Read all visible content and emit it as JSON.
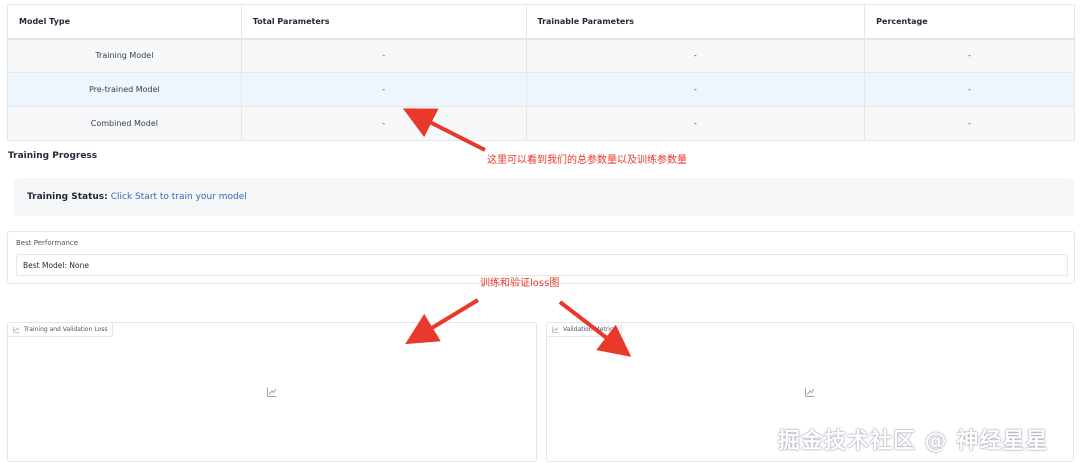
{
  "param_table": {
    "headers": [
      "Model Type",
      "Total Parameters",
      "Trainable Parameters",
      "Percentage"
    ],
    "rows": [
      [
        "Training Model",
        "-",
        "-",
        "-"
      ],
      [
        "Pre-trained Model",
        "-",
        "-",
        "-"
      ],
      [
        "Combined Model",
        "-",
        "-",
        "-"
      ]
    ]
  },
  "training_progress": {
    "title": "Training Progress",
    "status_label": "Training Status:",
    "status_value": "Click Start to train your model"
  },
  "best_performance": {
    "label": "Best Performance",
    "value": "Best Model: None"
  },
  "plots": {
    "left_title": "Training and Validation Loss",
    "right_title": "Validation Metrics",
    "icon": "chart-icon"
  },
  "annotations": {
    "params_note": "这里可以看到我们的总参数量以及训练参数量",
    "loss_note": "训练和验证loss图",
    "color": "#e8392c"
  },
  "watermark": "掘金技术社区 @ 神经星星"
}
